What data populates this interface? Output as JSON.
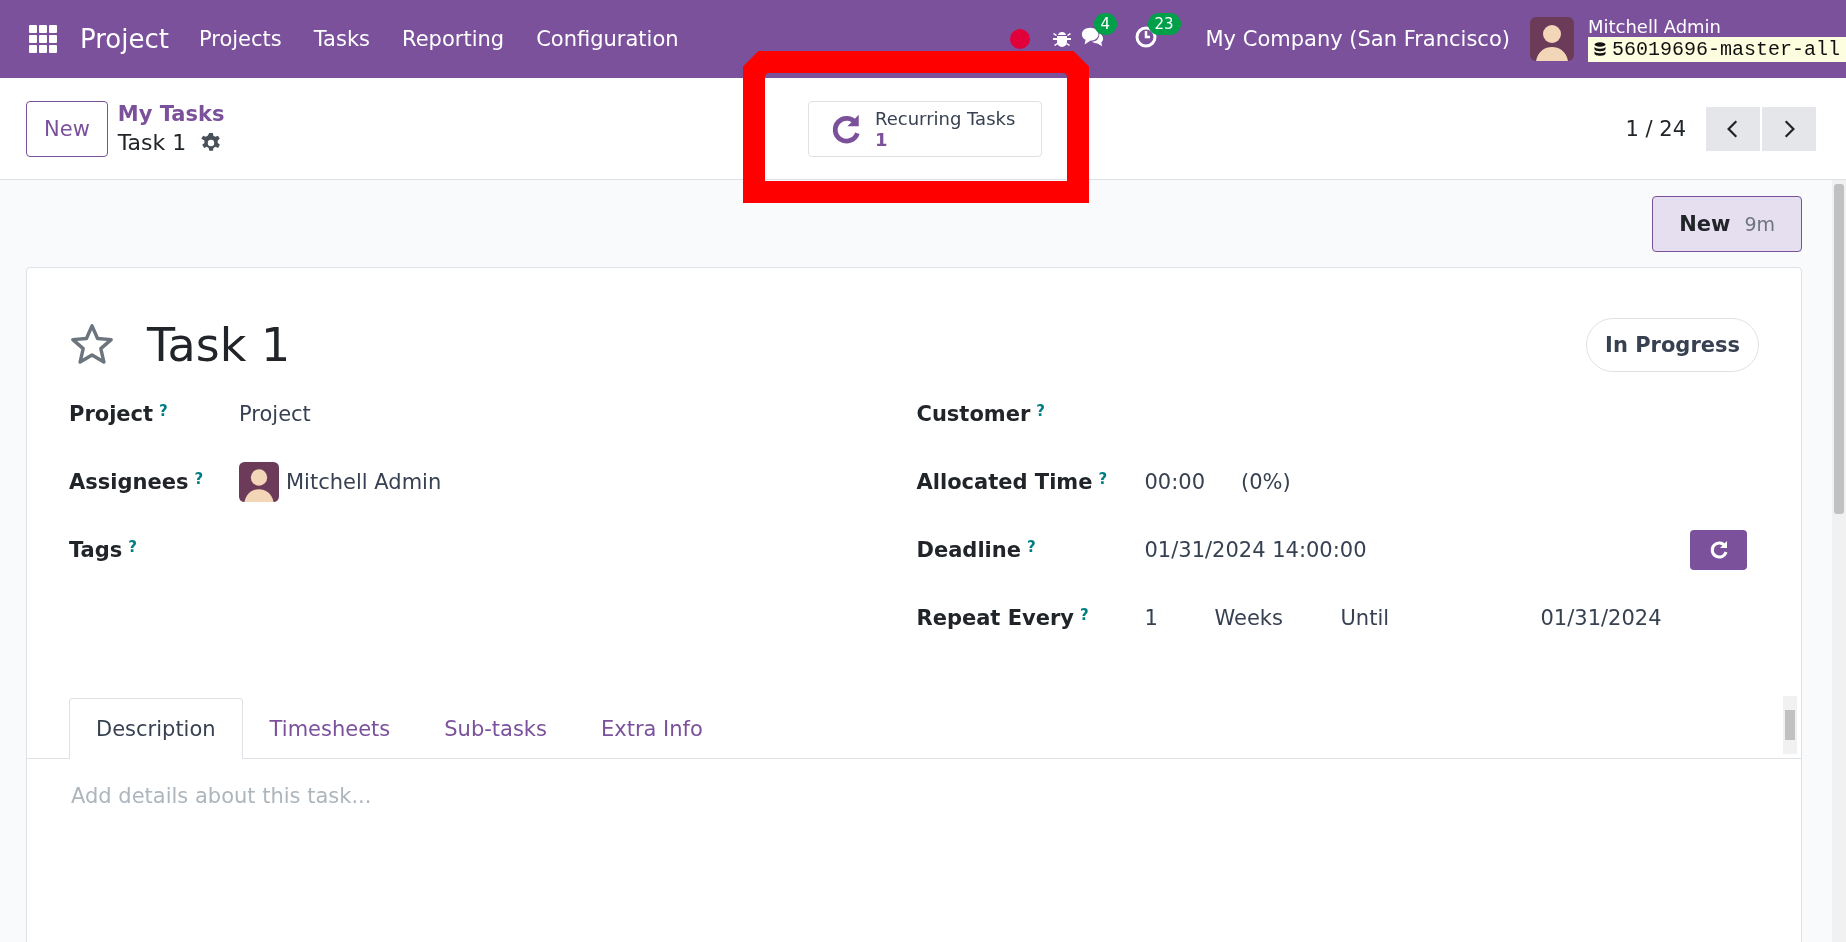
{
  "navbar": {
    "app_name": "Project",
    "menu": [
      "Projects",
      "Tasks",
      "Reporting",
      "Configuration"
    ],
    "messages_count": "4",
    "activities_count": "23",
    "company": "My Company (San Francisco)",
    "user_name": "Mitchell Admin",
    "database": "56019696-master-all"
  },
  "control_panel": {
    "new_button": "New",
    "breadcrumb_parent": "My Tasks",
    "breadcrumb_current": "Task 1",
    "smart_button": {
      "label": "Recurring Tasks",
      "count": "1"
    },
    "pager": "1 / 24"
  },
  "stage_button": {
    "label": "New",
    "duration": "9m"
  },
  "task": {
    "starred": false,
    "title": "Task 1",
    "status": "In Progress",
    "left_fields": [
      {
        "label": "Project",
        "help": "?",
        "kind": "text",
        "values": [
          "Project"
        ]
      },
      {
        "label": "Assignees",
        "help": "?",
        "kind": "user",
        "values": [
          "Mitchell Admin"
        ]
      },
      {
        "label": "Tags",
        "help": "?",
        "kind": "empty"
      }
    ],
    "right_fields": [
      {
        "label": "Customer",
        "help": "?",
        "kind": "empty"
      },
      {
        "label": "Allocated Time",
        "help": "?",
        "kind": "time",
        "values": [
          "00:00",
          "(0%)"
        ]
      },
      {
        "label": "Deadline",
        "help": "?",
        "kind": "date_button",
        "values": [
          "01/31/2024 14:00:00"
        ]
      },
      {
        "label": "Repeat Every",
        "help": "?",
        "kind": "repeat",
        "values": [
          "1",
          "Weeks",
          "Until",
          "01/31/2024"
        ]
      }
    ]
  },
  "tabs": [
    {
      "label": "Description",
      "selected": true
    },
    {
      "label": "Timesheets",
      "selected": false
    },
    {
      "label": "Sub-tasks",
      "selected": false
    },
    {
      "label": "Extra Info",
      "selected": false
    }
  ],
  "description": {
    "placeholder": "Add details about this task..."
  }
}
